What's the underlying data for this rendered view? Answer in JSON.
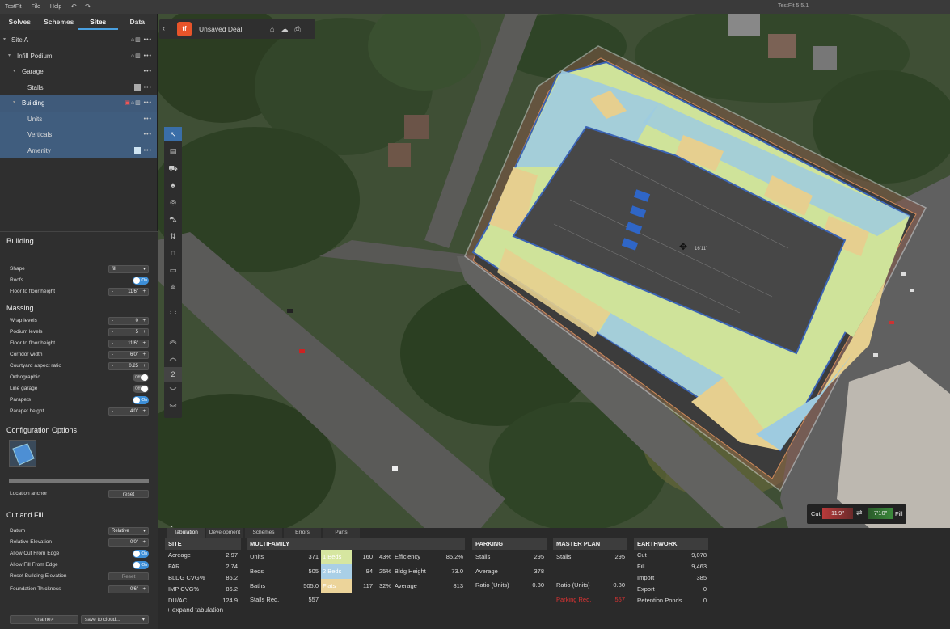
{
  "titlebar": {
    "app": "TestFit",
    "file": "File",
    "help": "Help",
    "undo_icon": "↶",
    "redo_icon": "↷",
    "version": "TestFit 5.5.1"
  },
  "tabs": [
    "Solves",
    "Schemes",
    "Sites",
    "Data"
  ],
  "tree": [
    {
      "label": "Site A",
      "depth": 0
    },
    {
      "label": "Infill Podium",
      "depth": 1
    },
    {
      "label": "Garage",
      "depth": 2
    },
    {
      "label": "Stalls",
      "depth": 3
    },
    {
      "label": "Building",
      "depth": 2
    },
    {
      "label": "Units",
      "depth": 3
    },
    {
      "label": "Verticals",
      "depth": 3
    },
    {
      "label": "Amenity",
      "depth": 3
    }
  ],
  "props": {
    "title": "Building",
    "shape_label": "Shape",
    "shape_value": "fill",
    "roofs_label": "Roofs",
    "roofs_value": "On",
    "f2f_label": "Floor to floor height",
    "f2f_value": "11'6\"",
    "massing_title": "Massing",
    "wrap_label": "Wrap levels",
    "wrap_value": "0",
    "podium_label": "Podium levels",
    "podium_value": "5",
    "f2f2_label": "Floor to floor height",
    "f2f2_value": "11'6\"",
    "corr_label": "Corridor width",
    "corr_value": "6'0\"",
    "court_label": "Courtyard aspect ratio",
    "court_value": "0.25",
    "ortho_label": "Orthographic",
    "ortho_value": "Off",
    "line_label": "Line garage",
    "line_value": "Off",
    "parapets_label": "Parapets",
    "parapets_value": "On",
    "parapet_h_label": "Parapet height",
    "parapet_h_value": "4'0\"",
    "config_title": "Configuration Options",
    "anchor_label": "Location anchor",
    "reset_label": "reset",
    "cutfill_title": "Cut and Fill",
    "datum_label": "Datum",
    "datum_value": "Relative",
    "relelev_label": "Relative Elevation",
    "relelev_value": "0'0\"",
    "allowcut_label": "Allow Cut From Edge",
    "allowcut_value": "On",
    "allowfill_label": "Allow Fill From Edge",
    "allowfill_value": "On",
    "resetelev_label": "Reset Building Elevation",
    "resetelev_btn": "Reset",
    "foundation_label": "Foundation Thickness",
    "foundation_value": "0'6\"",
    "name_btn": "<name>",
    "save_btn": "save to cloud..."
  },
  "map": {
    "deal_title": "Unsaved Deal",
    "cut_label": "Cut",
    "cut_value": "11'9\"",
    "fill_label": "Fill",
    "fill_value": "7'10\"",
    "center_label": "16'11\"",
    "colors": {
      "tan": "#e6cf8f",
      "green": "#cfe39a",
      "blue": "#9ecbe0",
      "asphalt": "#474747",
      "outline": "#3b64b5"
    }
  },
  "bottom": {
    "tabs": [
      "Tabulation",
      "Development",
      "Schemes",
      "Errors",
      "Parts"
    ],
    "site": {
      "title": "SITE",
      "rows": [
        [
          "Acreage",
          "2.97"
        ],
        [
          "FAR",
          "2.74"
        ],
        [
          "BLDG CVG%",
          "86.2"
        ],
        [
          "IMP CVG%",
          "86.2"
        ],
        [
          "DU/AC",
          "124.9"
        ]
      ]
    },
    "expand": "+ expand tabulation",
    "mf": {
      "title": "MULTIFAMILY",
      "rows": [
        [
          "Units",
          "371"
        ],
        [
          "Beds",
          "505"
        ],
        [
          "Baths",
          "505.0"
        ],
        [
          "Stalls Req.",
          "557"
        ]
      ],
      "mix": [
        [
          "1 Beds",
          "160",
          "43%"
        ],
        [
          "2 Beds",
          "94",
          "25%"
        ],
        [
          "Flats",
          "117",
          "32%"
        ]
      ],
      "stats": [
        [
          "Efficiency",
          "85.2%"
        ],
        [
          "Bldg Height",
          "73.0"
        ],
        [
          "Average",
          "813"
        ]
      ]
    },
    "parking": {
      "title": "PARKING",
      "rows": [
        [
          "Stalls",
          "295"
        ],
        [
          "Average",
          "378"
        ],
        [
          "Ratio (Units)",
          "0.80"
        ]
      ]
    },
    "master": {
      "title": "MASTER PLAN",
      "rows": [
        [
          "Stalls",
          "295"
        ],
        [
          "",
          ""
        ],
        [
          "Ratio (Units)",
          "0.80"
        ],
        [
          "Parking Req.",
          "557"
        ]
      ]
    },
    "earth": {
      "title": "EARTHWORK",
      "rows": [
        [
          "Cut",
          "9,078"
        ],
        [
          "Fill",
          "9,463"
        ],
        [
          "Import",
          "385"
        ],
        [
          "Export",
          "0"
        ],
        [
          "Retention Ponds",
          "0"
        ]
      ]
    }
  }
}
